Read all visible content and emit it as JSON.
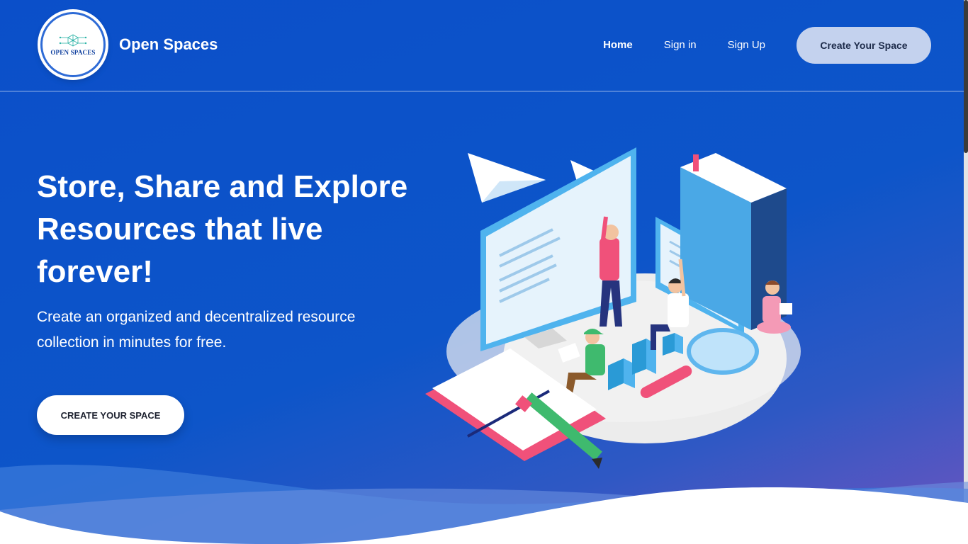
{
  "header": {
    "logo_text": "OPEN SPACES",
    "brand": "Open Spaces",
    "nav": {
      "home": "Home",
      "sign_in": "Sign in",
      "sign_up": "Sign Up",
      "create_space": "Create Your Space"
    }
  },
  "hero": {
    "title": "Store, Share and Explore Resources that live forever!",
    "subtitle": "Create an organized and decentralized resource collection in minutes for free.",
    "cta": "CREATE YOUR SPACE"
  },
  "colors": {
    "background": "#0b4fc9",
    "nav_button": "#c4d2ee",
    "accent_pink": "#f0517a"
  }
}
